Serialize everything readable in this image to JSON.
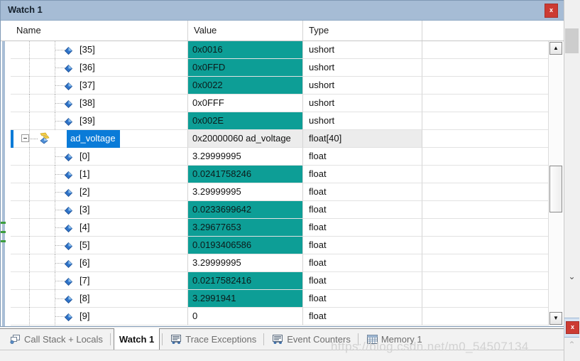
{
  "window": {
    "title": "Watch 1",
    "close_label": "x",
    "title_bg": "#a6bcd5",
    "close_bg": "#cc3b33"
  },
  "colors": {
    "changed_value_bg": "#0d9e96",
    "selection_bg": "#0a7bd8",
    "parent_row_bg": "#ececec"
  },
  "grid": {
    "columns": [
      "Name",
      "Value",
      "Type",
      ""
    ],
    "rows": [
      {
        "name": "[35]",
        "value": "0x0016",
        "type": "ushort",
        "icon": "diamond-icon",
        "changed": true,
        "selected": false,
        "parent": false
      },
      {
        "name": "[36]",
        "value": "0x0FFD",
        "type": "ushort",
        "icon": "diamond-icon",
        "changed": true,
        "selected": false,
        "parent": false
      },
      {
        "name": "[37]",
        "value": "0x0022",
        "type": "ushort",
        "icon": "diamond-icon",
        "changed": true,
        "selected": false,
        "parent": false
      },
      {
        "name": "[38]",
        "value": "0x0FFF",
        "type": "ushort",
        "icon": "diamond-icon",
        "changed": false,
        "selected": false,
        "parent": false
      },
      {
        "name": "[39]",
        "value": "0x002E",
        "type": "ushort",
        "icon": "diamond-icon",
        "changed": true,
        "selected": false,
        "parent": false
      },
      {
        "name": "ad_voltage",
        "value": "0x20000060 ad_voltage",
        "type": "float[40]",
        "icon": "array-variable-icon",
        "changed": false,
        "selected": true,
        "parent": true
      },
      {
        "name": "[0]",
        "value": "3.29999995",
        "type": "float",
        "icon": "diamond-icon",
        "changed": false,
        "selected": false,
        "parent": false
      },
      {
        "name": "[1]",
        "value": "0.0241758246",
        "type": "float",
        "icon": "diamond-icon",
        "changed": true,
        "selected": false,
        "parent": false
      },
      {
        "name": "[2]",
        "value": "3.29999995",
        "type": "float",
        "icon": "diamond-icon",
        "changed": false,
        "selected": false,
        "parent": false
      },
      {
        "name": "[3]",
        "value": "0.0233699642",
        "type": "float",
        "icon": "diamond-icon",
        "changed": true,
        "selected": false,
        "parent": false
      },
      {
        "name": "[4]",
        "value": "3.29677653",
        "type": "float",
        "icon": "diamond-icon",
        "changed": true,
        "selected": false,
        "parent": false
      },
      {
        "name": "[5]",
        "value": "0.0193406586",
        "type": "float",
        "icon": "diamond-icon",
        "changed": true,
        "selected": false,
        "parent": false
      },
      {
        "name": "[6]",
        "value": "3.29999995",
        "type": "float",
        "icon": "diamond-icon",
        "changed": false,
        "selected": false,
        "parent": false
      },
      {
        "name": "[7]",
        "value": "0.0217582416",
        "type": "float",
        "icon": "diamond-icon",
        "changed": true,
        "selected": false,
        "parent": false
      },
      {
        "name": "[8]",
        "value": "3.2991941",
        "type": "float",
        "icon": "diamond-icon",
        "changed": true,
        "selected": false,
        "parent": false
      },
      {
        "name": "[9]",
        "value": "0",
        "type": "float",
        "icon": "diamond-icon",
        "changed": false,
        "selected": false,
        "parent": false
      }
    ]
  },
  "scrollbar": {
    "up_glyph": "▲",
    "down_glyph": "▼"
  },
  "tabs": [
    {
      "label": "Call Stack + Locals",
      "icon": "call-stack-icon",
      "active": false
    },
    {
      "label": "Watch 1",
      "icon": "none",
      "active": true
    },
    {
      "label": "Trace Exceptions",
      "icon": "trace-icon",
      "active": false
    },
    {
      "label": "Event Counters",
      "icon": "event-counters-icon",
      "active": false
    },
    {
      "label": "Memory 1",
      "icon": "memory-icon",
      "active": false
    }
  ],
  "outer": {
    "chevron_glyph": "⌄",
    "close_label": "x",
    "caret_glyph": "⌃"
  },
  "watermark": "https://blog.csdn.net/m0_54507134"
}
